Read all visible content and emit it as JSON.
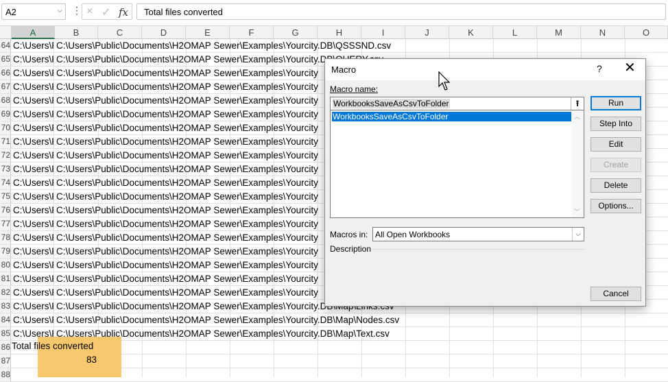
{
  "formula_bar": {
    "name_box": "A2",
    "cancel_icon": "×",
    "confirm_icon": "✓",
    "fx_label": "fx",
    "formula": "Total files converted"
  },
  "columns": [
    "A",
    "B",
    "C",
    "D",
    "E",
    "F",
    "G",
    "H",
    "I",
    "J",
    "K",
    "L",
    "M",
    "N",
    "O"
  ],
  "rows": [
    {
      "num": "64",
      "a": "C:\\Users\\Public\\Documents",
      "b": "C:\\Users\\Public\\Documents\\H2OMAP Sewer\\Examples\\Yourcity.DB\\QSSSND.csv"
    },
    {
      "num": "65",
      "a": "C:\\Users\\Public\\Documents",
      "b": "C:\\Users\\Public\\Documents\\H2OMAP Sewer\\Examples\\Yourcity.DB\\QUERY.csv"
    },
    {
      "num": "66",
      "a": "C:\\Users\\Public\\Documents",
      "b": "C:\\Users\\Public\\Documents\\H2OMAP Sewer\\Examples\\Yourcity"
    },
    {
      "num": "67",
      "a": "C:\\Users\\Public\\Documents",
      "b": "C:\\Users\\Public\\Documents\\H2OMAP Sewer\\Examples\\Yourcity"
    },
    {
      "num": "68",
      "a": "C:\\Users\\Public\\Documents",
      "b": "C:\\Users\\Public\\Documents\\H2OMAP Sewer\\Examples\\Yourcity"
    },
    {
      "num": "69",
      "a": "C:\\Users\\Public\\Documents",
      "b": "C:\\Users\\Public\\Documents\\H2OMAP Sewer\\Examples\\Yourcity"
    },
    {
      "num": "70",
      "a": "C:\\Users\\Public\\Documents",
      "b": "C:\\Users\\Public\\Documents\\H2OMAP Sewer\\Examples\\Yourcity"
    },
    {
      "num": "71",
      "a": "C:\\Users\\Public\\Documents",
      "b": "C:\\Users\\Public\\Documents\\H2OMAP Sewer\\Examples\\Yourcity"
    },
    {
      "num": "72",
      "a": "C:\\Users\\Public\\Documents",
      "b": "C:\\Users\\Public\\Documents\\H2OMAP Sewer\\Examples\\Yourcity"
    },
    {
      "num": "73",
      "a": "C:\\Users\\Public\\Documents",
      "b": "C:\\Users\\Public\\Documents\\H2OMAP Sewer\\Examples\\Yourcity"
    },
    {
      "num": "74",
      "a": "C:\\Users\\Public\\Documents",
      "b": "C:\\Users\\Public\\Documents\\H2OMAP Sewer\\Examples\\Yourcity"
    },
    {
      "num": "75",
      "a": "C:\\Users\\Public\\Documents",
      "b": "C:\\Users\\Public\\Documents\\H2OMAP Sewer\\Examples\\Yourcity"
    },
    {
      "num": "76",
      "a": "C:\\Users\\Public\\Documents",
      "b": "C:\\Users\\Public\\Documents\\H2OMAP Sewer\\Examples\\Yourcity"
    },
    {
      "num": "77",
      "a": "C:\\Users\\Public\\Documents",
      "b": "C:\\Users\\Public\\Documents\\H2OMAP Sewer\\Examples\\Yourcity"
    },
    {
      "num": "78",
      "a": "C:\\Users\\Public\\Documents",
      "b": "C:\\Users\\Public\\Documents\\H2OMAP Sewer\\Examples\\Yourcity"
    },
    {
      "num": "79",
      "a": "C:\\Users\\Public\\Documents",
      "b": "C:\\Users\\Public\\Documents\\H2OMAP Sewer\\Examples\\Yourcity"
    },
    {
      "num": "80",
      "a": "C:\\Users\\Public\\Documents",
      "b": "C:\\Users\\Public\\Documents\\H2OMAP Sewer\\Examples\\Yourcity"
    },
    {
      "num": "81",
      "a": "C:\\Users\\Public\\Documents",
      "b": "C:\\Users\\Public\\Documents\\H2OMAP Sewer\\Examples\\Yourcity"
    },
    {
      "num": "82",
      "a": "C:\\Users\\Public\\Documents",
      "b": "C:\\Users\\Public\\Documents\\H2OMAP Sewer\\Examples\\Yourcity"
    },
    {
      "num": "83",
      "a": "C:\\Users\\Public\\Documents",
      "b": "C:\\Users\\Public\\Documents\\H2OMAP Sewer\\Examples\\Yourcity.DB\\Map\\Links.csv"
    },
    {
      "num": "84",
      "a": "C:\\Users\\Public\\Documents",
      "b": "C:\\Users\\Public\\Documents\\H2OMAP Sewer\\Examples\\Yourcity.DB\\Map\\Nodes.csv"
    },
    {
      "num": "85",
      "a": "C:\\Users\\Public\\Documents",
      "b": "C:\\Users\\Public\\Documents\\H2OMAP Sewer\\Examples\\Yourcity.DB\\Map\\Text.csv"
    },
    {
      "num": "86",
      "a": "",
      "b": ""
    },
    {
      "num": "87",
      "a": "",
      "b": ""
    },
    {
      "num": "88",
      "a": "",
      "b": ""
    }
  ],
  "summary": {
    "a36_label": "Total files converted",
    "b37_value": "83",
    "highlight_color": "#f6c25d"
  },
  "dialog": {
    "title": "Macro",
    "help": "?",
    "close": "✕",
    "macro_name_label": "Macro name:",
    "macro_name_value": "WorkbooksSaveAsCsvToFolder",
    "macro_list": [
      "WorkbooksSaveAsCsvToFolder"
    ],
    "buttons": {
      "run": "Run",
      "step_into": "Step Into",
      "edit": "Edit",
      "create": "Create",
      "delete": "Delete",
      "options": "Options...",
      "cancel": "Cancel"
    },
    "macros_in_label": "Macros in:",
    "macros_in_value": "All Open Workbooks",
    "description_label": "Description"
  }
}
